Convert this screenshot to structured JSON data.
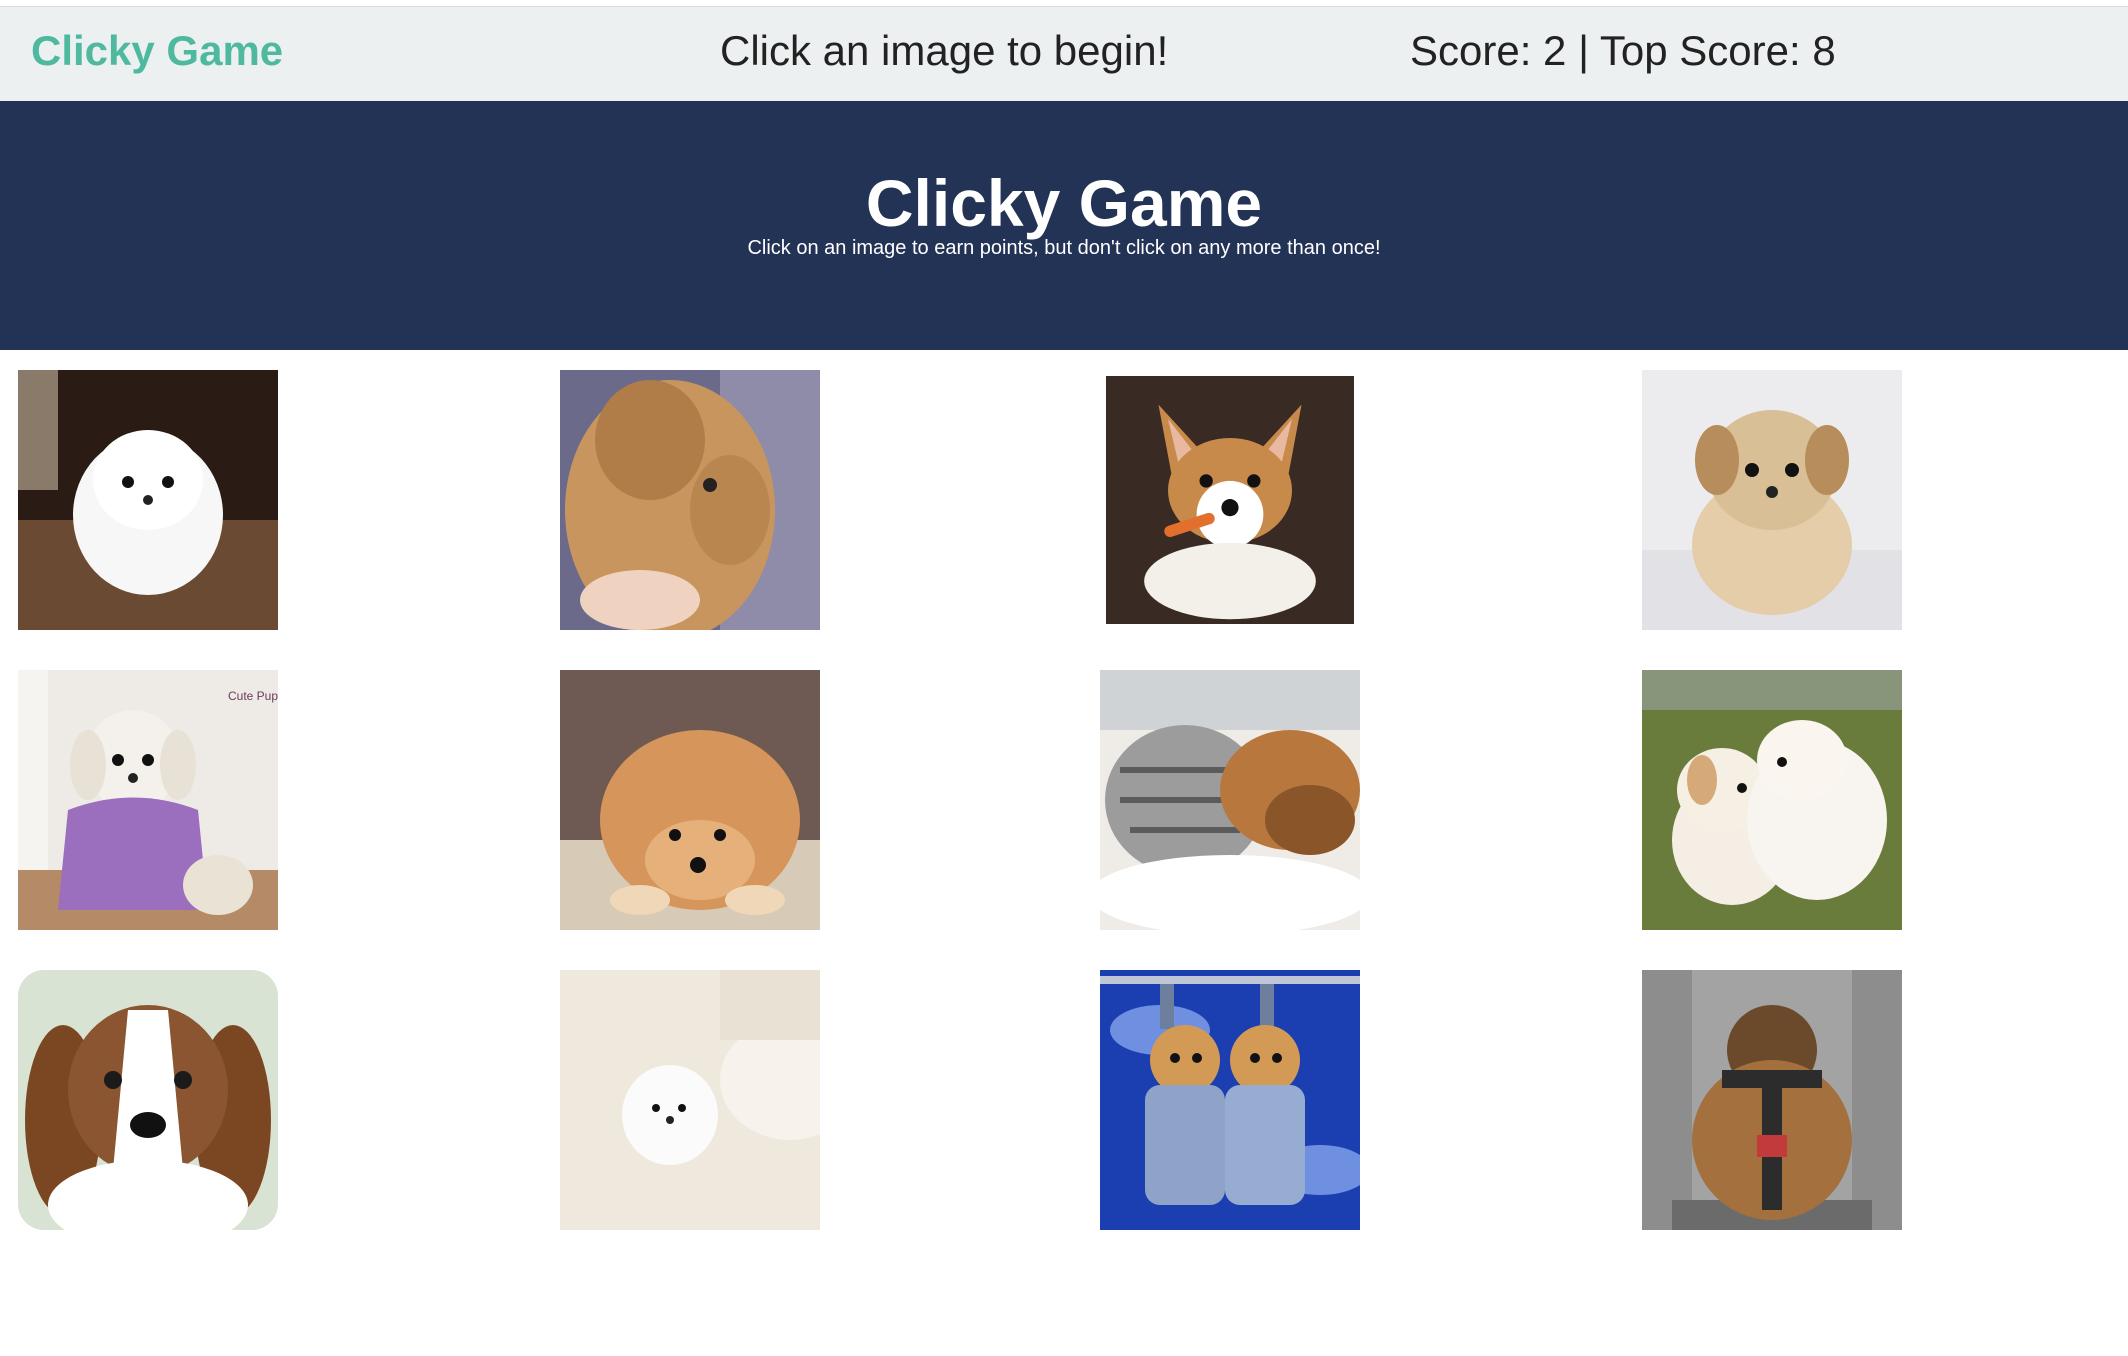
{
  "navbar": {
    "brand": "Clicky Game",
    "message": "Click an image to begin!",
    "score_text": "Score: 2 | Top Score: 8"
  },
  "hero": {
    "title": "Clicky Game",
    "subtitle": "Click on an image to earn points, but don't click on any more than once!"
  },
  "cards": [
    {
      "icon": "white-pomeranian-puppy",
      "bg": "#5a3b28",
      "fur": "#f7f7f7"
    },
    {
      "icon": "golden-puppy-paw",
      "bg": "#6b6a8a",
      "fur": "#c9955e"
    },
    {
      "icon": "corgi-puppy",
      "bg": "#3a2a24",
      "fur": "#c88a4b"
    },
    {
      "icon": "fluffy-cream-puppy",
      "bg": "#ececef",
      "fur": "#d9bf96"
    },
    {
      "icon": "maltese-in-purple-robe",
      "bg": "#c39a76",
      "fur": "#f2efea"
    },
    {
      "icon": "orange-pomeranian-lying",
      "bg": "#6e5a52",
      "fur": "#d6955a"
    },
    {
      "icon": "kitten-and-puppy-sleeping",
      "bg": "#efece7",
      "fur": "#b7773d"
    },
    {
      "icon": "two-puppies-on-grass",
      "bg": "#6a7c3c",
      "fur": "#f4eee4"
    },
    {
      "icon": "beagle-puppy",
      "bg": "#d9e3d4",
      "fur": "#8a5530"
    },
    {
      "icon": "tiny-white-pomeranian",
      "bg": "#efe8dc",
      "fur": "#fbfbfb"
    },
    {
      "icon": "puppies-in-overalls",
      "bg": "#1b3fb0",
      "fur": "#d39a55"
    },
    {
      "icon": "yorkie-in-car-seat",
      "bg": "#8d8d8d",
      "fur": "#a4713e"
    }
  ]
}
